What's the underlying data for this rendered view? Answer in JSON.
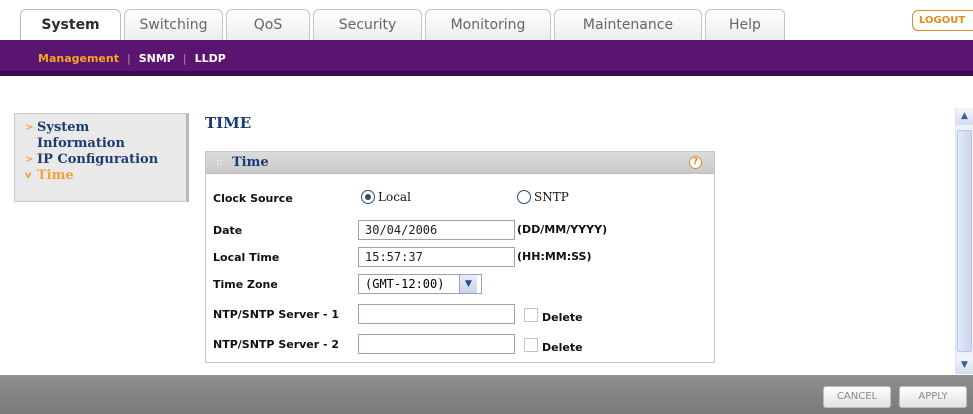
{
  "tabs": [
    {
      "label": "System",
      "active": true
    },
    {
      "label": "Switching",
      "active": false
    },
    {
      "label": "QoS",
      "active": false
    },
    {
      "label": "Security",
      "active": false
    },
    {
      "label": "Monitoring",
      "active": false
    },
    {
      "label": "Maintenance",
      "active": false
    },
    {
      "label": "Help",
      "active": false
    }
  ],
  "logout_label": "LOGOUT",
  "subnav": {
    "items": [
      {
        "label": "Management",
        "active": true
      },
      {
        "label": "SNMP",
        "active": false
      },
      {
        "label": "LLDP",
        "active": false
      }
    ]
  },
  "sidebar": {
    "items": [
      {
        "label": "System Information",
        "active": false
      },
      {
        "label": "IP Configuration",
        "active": false
      },
      {
        "label": "Time",
        "active": true
      }
    ]
  },
  "page_title": "TIME",
  "panel": {
    "title": "Time",
    "clock_source": {
      "label": "Clock Source",
      "options": [
        {
          "label": "Local",
          "selected": true
        },
        {
          "label": "SNTP",
          "selected": false
        }
      ]
    },
    "date": {
      "label": "Date",
      "value": "30/04/2006",
      "hint": "(DD/MM/YYYY)"
    },
    "local_time": {
      "label": "Local Time",
      "value": "15:57:37",
      "hint": "(HH:MM:SS)"
    },
    "time_zone": {
      "label": "Time Zone",
      "value": "(GMT-12:00)"
    },
    "ntp1": {
      "label": "NTP/SNTP Server - 1",
      "value": "",
      "delete_label": "Delete"
    },
    "ntp2": {
      "label": "NTP/SNTP Server - 2",
      "value": "",
      "delete_label": "Delete"
    }
  },
  "buttons": {
    "cancel": "CANCEL",
    "apply": "APPLY"
  },
  "colors": {
    "brand_purple": "#5a1570",
    "accent_orange": "#f0a43a",
    "title_blue": "#1b3b77"
  }
}
